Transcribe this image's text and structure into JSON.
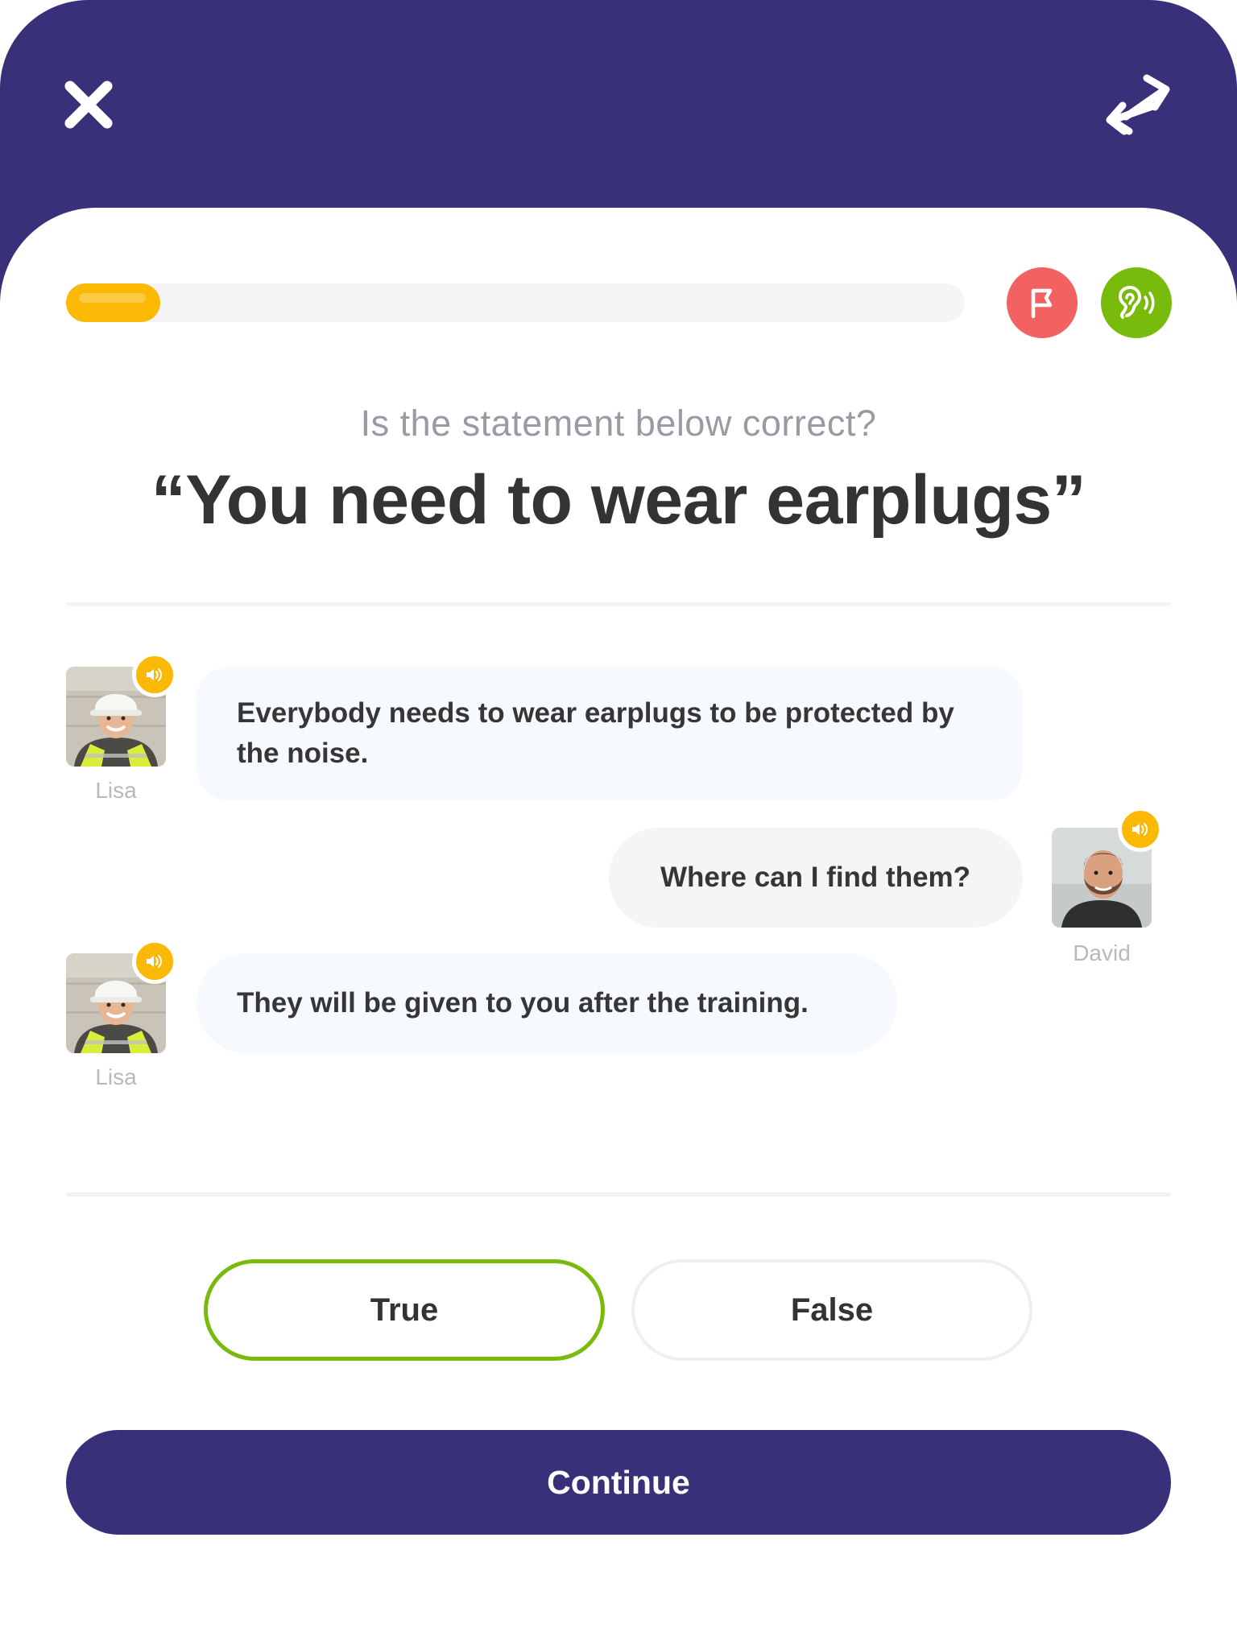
{
  "colors": {
    "brand": "#383078",
    "progress": "#fbb905",
    "flag": "#f26262",
    "listen": "#78bb0c",
    "selected_border": "#78bb0c"
  },
  "progress": {
    "value": 0.105
  },
  "icons": {
    "close": "close-icon",
    "swap": "swap-arrows-icon",
    "flag": "flag-icon",
    "listen": "ear-icon",
    "speaker": "speaker-icon"
  },
  "question": {
    "instruction": "Is the statement below correct?",
    "statement": "“You need to wear earplugs”"
  },
  "dialogue": [
    {
      "speaker": "Lisa",
      "side": "left",
      "text": "Everybody needs to wear earplugs to be protected by the noise."
    },
    {
      "speaker": "David",
      "side": "right",
      "text": "Where can I find them?"
    },
    {
      "speaker": "Lisa",
      "side": "left",
      "text": "They will be given to you after the training."
    }
  ],
  "answers": {
    "true_label": "True",
    "false_label": "False",
    "selected": "True"
  },
  "continue_label": "Continue"
}
